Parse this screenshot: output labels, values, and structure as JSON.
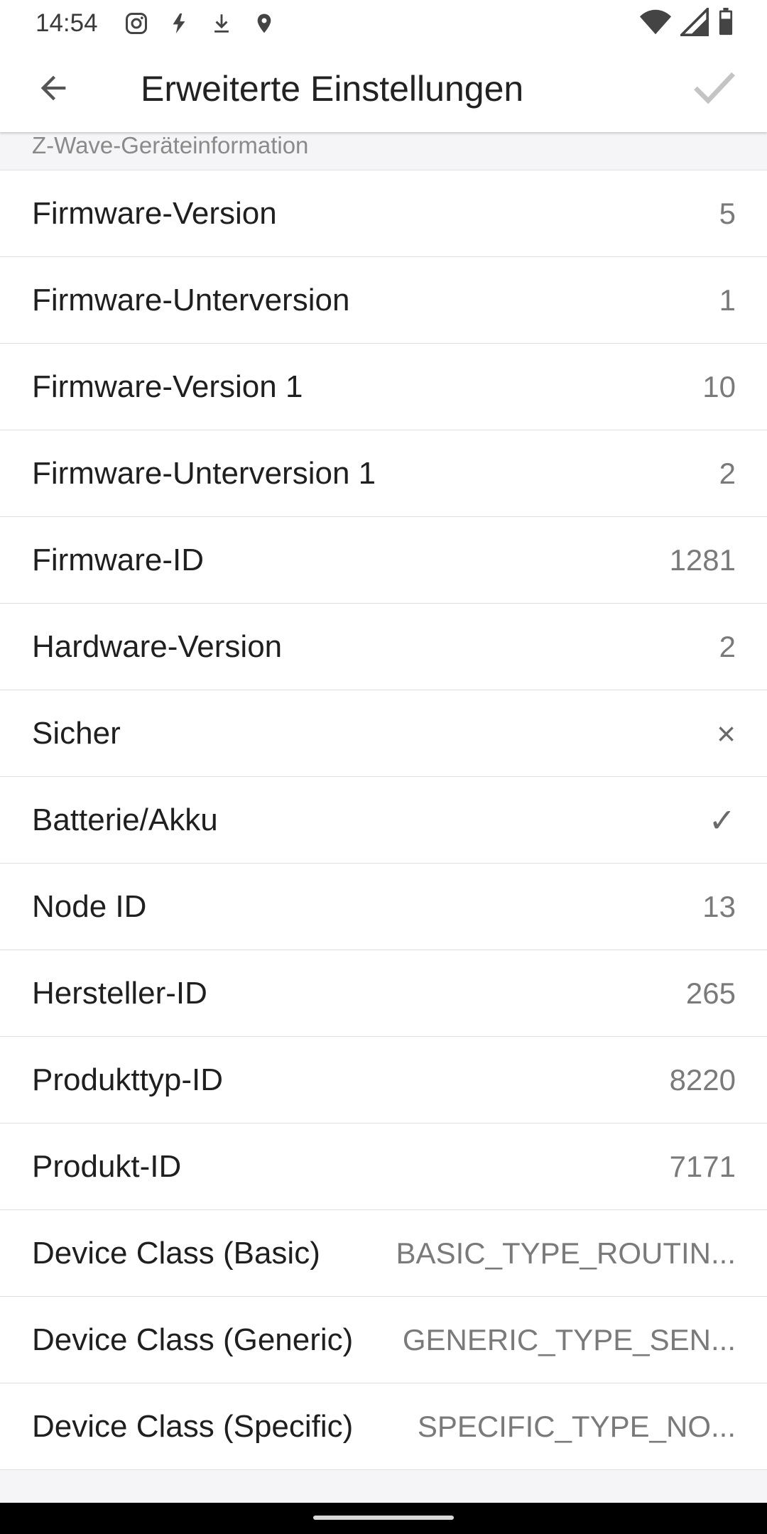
{
  "status_bar": {
    "time": "14:54",
    "icons_left": [
      "instagram-icon",
      "flash-icon",
      "download-icon",
      "location-icon"
    ],
    "icons_right": [
      "wifi-icon",
      "signal-icon",
      "battery-icon"
    ]
  },
  "app_bar": {
    "title": "Erweiterte Einstellungen",
    "back_icon": "arrow-back-icon",
    "confirm_icon": "checkmark-icon"
  },
  "section": {
    "title": "Z-Wave-Geräteinformation"
  },
  "rows": [
    {
      "label": "Firmware-Version",
      "value": "5"
    },
    {
      "label": "Firmware-Unterversion",
      "value": "1"
    },
    {
      "label": "Firmware-Version 1",
      "value": "10"
    },
    {
      "label": "Firmware-Unterversion 1",
      "value": "2"
    },
    {
      "label": "Firmware-ID",
      "value": "1281"
    },
    {
      "label": "Hardware-Version",
      "value": "2"
    },
    {
      "label": "Sicher",
      "value": "×"
    },
    {
      "label": "Batterie/Akku",
      "value": "✓"
    },
    {
      "label": "Node ID",
      "value": "13"
    },
    {
      "label": "Hersteller-ID",
      "value": "265"
    },
    {
      "label": "Produkttyp-ID",
      "value": "8220"
    },
    {
      "label": "Produkt-ID",
      "value": "7171"
    },
    {
      "label": "Device Class (Basic)",
      "value": "BASIC_TYPE_ROUTIN..."
    },
    {
      "label": "Device Class (Generic)",
      "value": "GENERIC_TYPE_SEN..."
    },
    {
      "label": "Device Class (Specific)",
      "value": "SPECIFIC_TYPE_NO..."
    }
  ],
  "colors": {
    "background": "#ffffff",
    "section_background": "#f5f5f7",
    "label_text": "#1f1f1f",
    "value_text": "#7a7a7a",
    "confirm_disabled": "#c4c4c4"
  }
}
